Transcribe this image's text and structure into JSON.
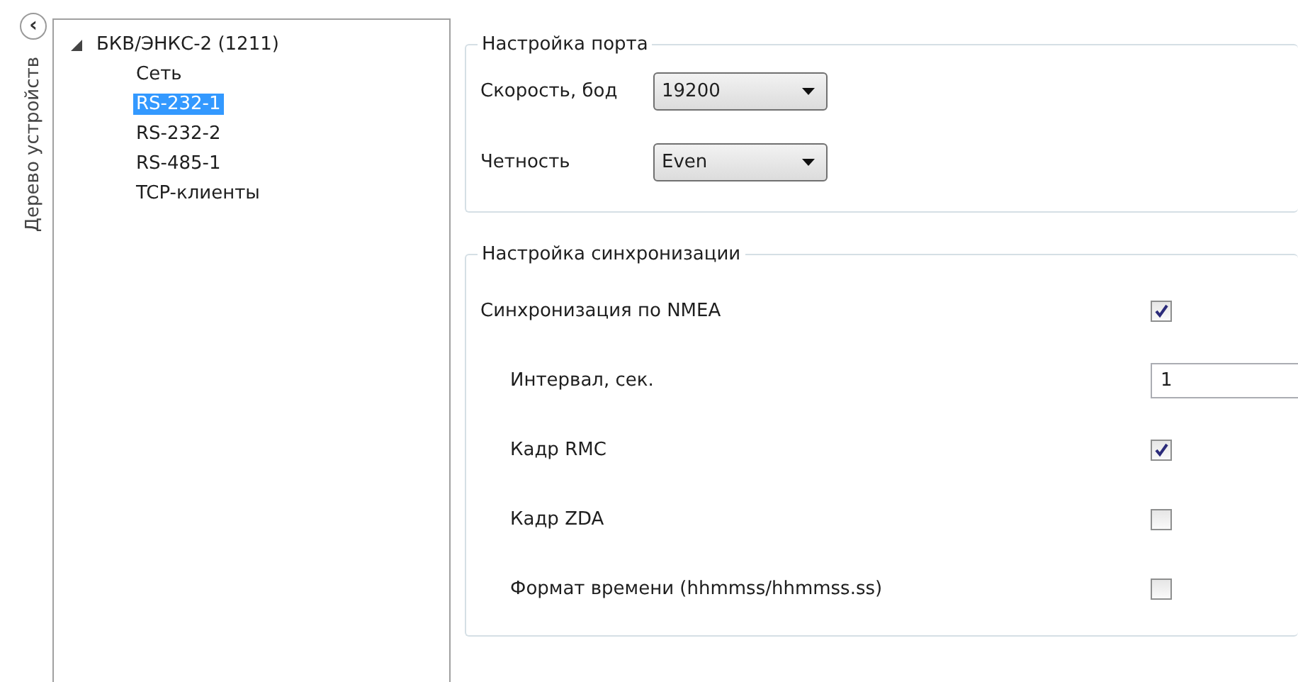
{
  "side_strip": {
    "collapse_button": "‹",
    "title": "Дерево устройств"
  },
  "tree": {
    "items": [
      {
        "label": "БКВ/ЭНКС-2 (1211)",
        "expanded": true,
        "selected": false,
        "children": [
          {
            "label": "Сеть",
            "selected": false
          },
          {
            "label": "RS-232-1",
            "selected": true
          },
          {
            "label": "RS-232-2",
            "selected": false
          },
          {
            "label": "RS-485-1",
            "selected": false
          },
          {
            "label": "TCP-клиенты",
            "selected": false
          }
        ]
      }
    ]
  },
  "port_group": {
    "title": "Настройка порта",
    "fields": [
      {
        "label": "Скорость, бод",
        "value": "19200"
      },
      {
        "label": "Четность",
        "value": "Even"
      }
    ]
  },
  "sync_group": {
    "title": "Настройка синхронизации",
    "rows": [
      {
        "kind": "checkbox",
        "label": "Синхронизация по NMEA",
        "checked": true,
        "children": [
          {
            "kind": "input",
            "label": "Интервал, сек.",
            "value": "1"
          },
          {
            "kind": "checkbox",
            "label": "Кадр RMC",
            "checked": true
          },
          {
            "kind": "checkbox",
            "label": "Кадр ZDA",
            "checked": false
          },
          {
            "kind": "checkbox",
            "label": "Формат времени (hhmmss/hhmmss.ss)",
            "checked": false
          }
        ]
      }
    ]
  }
}
